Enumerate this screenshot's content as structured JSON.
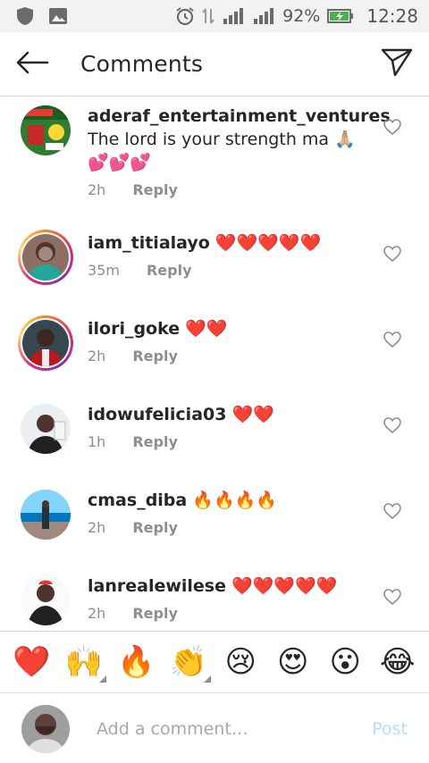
{
  "status": {
    "battery_pct": "92%",
    "time": "12:28"
  },
  "header": {
    "title": "Comments"
  },
  "comments": [
    {
      "username": "aderaf_entertainment_ventures",
      "text": "The lord is your strength ma 🙏🏼",
      "text2": "💕💕💕",
      "time": "2h",
      "reply": "Reply",
      "ring": false
    },
    {
      "username": "iam_titialayo",
      "text": "❤️❤️❤️❤️❤️",
      "time": "35m",
      "reply": "Reply",
      "ring": true
    },
    {
      "username": "ilori_goke",
      "text": "❤️❤️",
      "time": "2h",
      "reply": "Reply",
      "ring": true
    },
    {
      "username": "idowufelicia03",
      "text": "❤️❤️",
      "time": "1h",
      "reply": "Reply",
      "ring": false
    },
    {
      "username": "cmas_diba",
      "text": "🔥🔥🔥🔥",
      "time": "2h",
      "reply": "Reply",
      "ring": false
    },
    {
      "username": "lanrealewilese",
      "text": "❤️❤️❤️❤️❤️",
      "time": "2h",
      "reply": "Reply",
      "ring": false
    }
  ],
  "emoji_bar": [
    "❤️",
    "🙌",
    "🔥",
    "👏",
    "😢",
    "😍",
    "😮",
    "😂"
  ],
  "input": {
    "placeholder": "Add a comment…",
    "post_label": "Post"
  },
  "colors": {
    "post_disabled": "#b2dffc",
    "meta_gray": "#8e8e8e"
  }
}
